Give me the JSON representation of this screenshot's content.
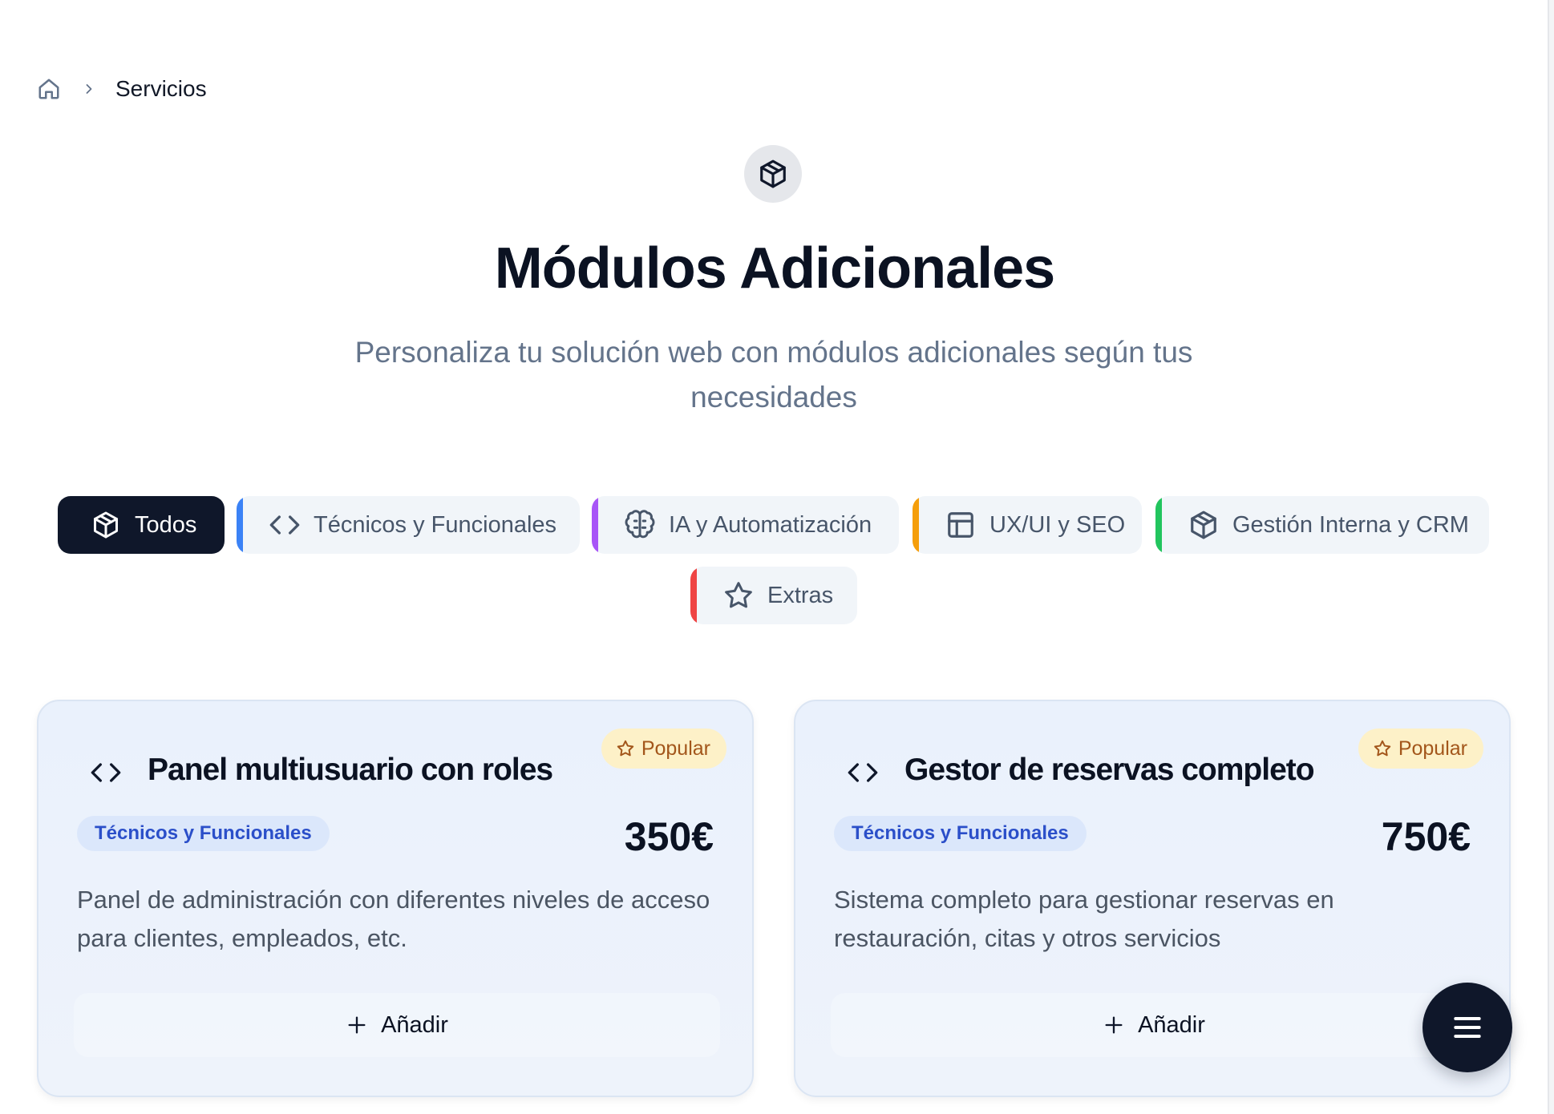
{
  "breadcrumb": {
    "home_icon": "home-icon",
    "separator_icon": "chevron-right-icon",
    "current": "Servicios"
  },
  "hero": {
    "icon": "package-icon",
    "title": "Módulos Adicionales",
    "subtitle": "Personaliza tu solución web con módulos adicionales según tus necesidades"
  },
  "tabs": [
    {
      "label": "Todos",
      "icon": "package-icon",
      "active": true,
      "accent": "#0f172a"
    },
    {
      "label": "Técnicos y Funcionales",
      "icon": "code-icon",
      "active": false,
      "accent": "#3b82f6"
    },
    {
      "label": "IA y Automatización",
      "icon": "brain-icon",
      "active": false,
      "accent": "#a855f7"
    },
    {
      "label": "UX/UI y SEO",
      "icon": "layout-icon",
      "active": false,
      "accent": "#f59e0b"
    },
    {
      "label": "Gestión Interna y CRM",
      "icon": "package-icon",
      "active": false,
      "accent": "#22c55e"
    },
    {
      "label": "Extras",
      "icon": "star-icon",
      "active": false,
      "accent": "#ef4444"
    }
  ],
  "cards": [
    {
      "icon": "code-icon",
      "title": "Panel multiusuario con roles",
      "badge": "Popular",
      "category": "Técnicos y Funcionales",
      "price": "350€",
      "description": "Panel de administración con diferentes niveles de acceso para clientes, empleados, etc.",
      "add_label": "Añadir"
    },
    {
      "icon": "code-icon",
      "title": "Gestor de reservas completo",
      "badge": "Popular",
      "category": "Técnicos y Funcionales",
      "price": "750€",
      "description": "Sistema completo para gestionar reservas en restauración, citas y otros servicios",
      "add_label": "Añadir"
    }
  ],
  "fab": {
    "icon": "menu-icon"
  },
  "colors": {
    "primary": "#0f172a",
    "muted_text": "#64748b",
    "category_badge_text": "#2b4fc9",
    "category_badge_bg": "#dbe7fb",
    "popular_bg": "#fdf1c8",
    "popular_text": "#a3561b"
  }
}
